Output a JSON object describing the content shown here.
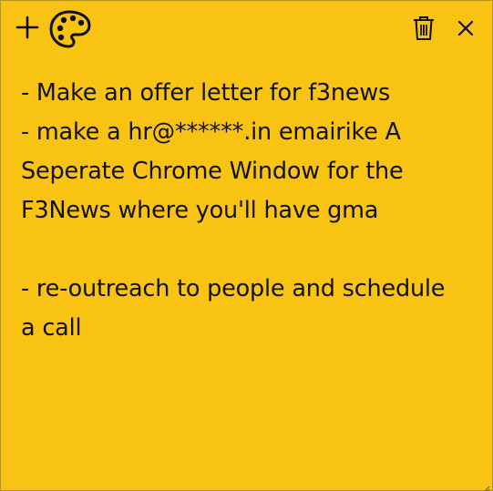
{
  "window": {
    "background_color": "#f9c314"
  },
  "toolbar": {
    "add_icon": "plus-icon",
    "palette_icon": "palette-icon",
    "delete_icon": "trash-icon",
    "close_icon": "close-icon"
  },
  "note": {
    "lines": [
      "- Make an offer letter for f3news",
      "- make a hr@******.in emairike A",
      "Seperate Chrome Window for the",
      "F3News where you'll have gma",
      "",
      "- re-outreach to people and schedule",
      "a call"
    ]
  },
  "resize_icon": "resize-grip-icon"
}
